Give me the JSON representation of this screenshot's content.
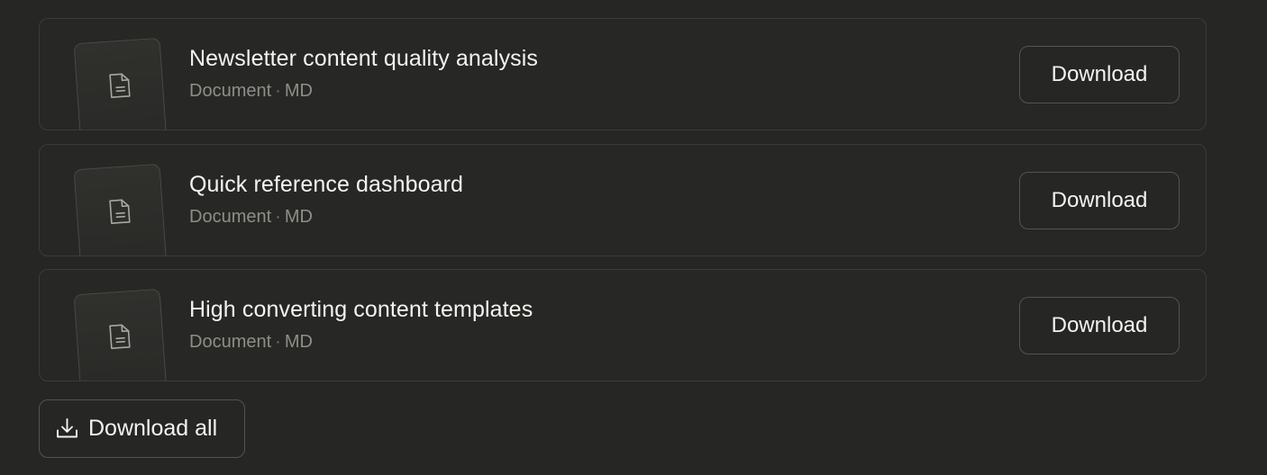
{
  "files": [
    {
      "title": "Newsletter content quality analysis",
      "type": "Document",
      "separator": "·",
      "format": "MD",
      "action": "Download",
      "icon": "document-icon"
    },
    {
      "title": "Quick reference dashboard",
      "type": "Document",
      "separator": "·",
      "format": "MD",
      "action": "Download",
      "icon": "document-icon"
    },
    {
      "title": "High converting content templates",
      "type": "Document",
      "separator": "·",
      "format": "MD",
      "action": "Download",
      "icon": "document-icon"
    }
  ],
  "download_all": {
    "label": "Download all",
    "icon": "download-tray-icon"
  },
  "colors": {
    "background": "#262624",
    "card_border": "#3c3b38",
    "button_border": "#54534f",
    "text_primary": "#f4f3ef",
    "text_secondary": "#8f8d87"
  }
}
